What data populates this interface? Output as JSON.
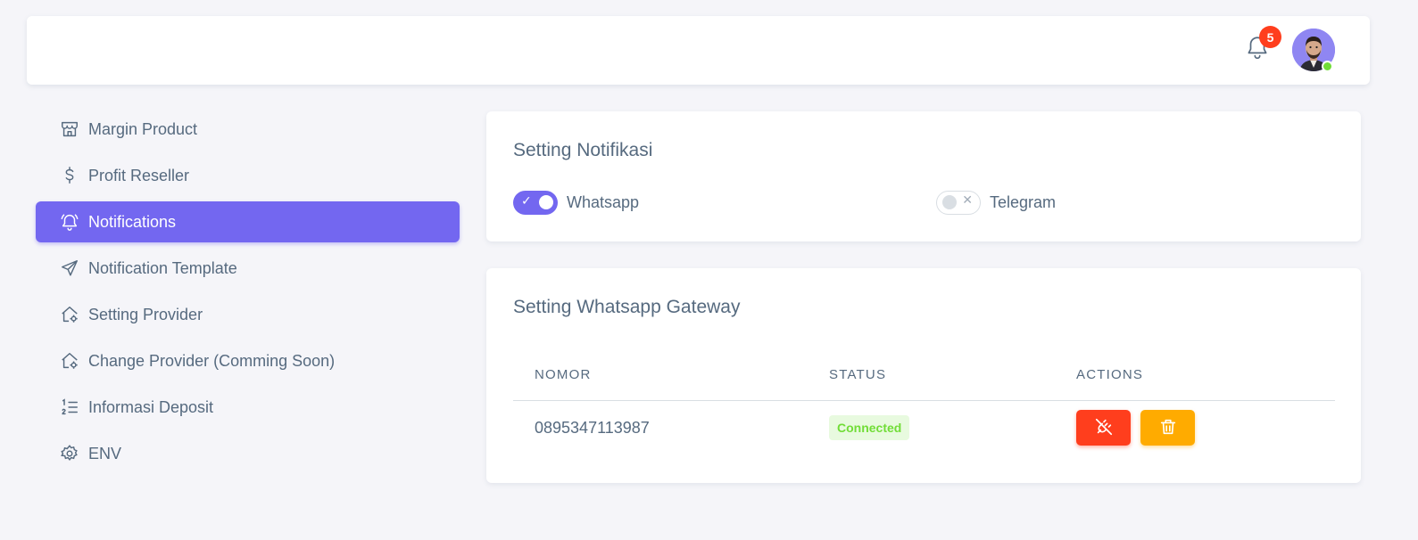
{
  "header": {
    "notifications_count": "5",
    "icons": [
      "bell-icon",
      "user-avatar"
    ]
  },
  "sidebar": {
    "items": [
      {
        "label": "Margin Product",
        "icon": "store-icon",
        "active": false
      },
      {
        "label": "Profit Reseller",
        "icon": "dollar-icon",
        "active": false
      },
      {
        "label": "Notifications",
        "icon": "bell-ringing-icon",
        "active": true
      },
      {
        "label": "Notification Template",
        "icon": "send-icon",
        "active": false
      },
      {
        "label": "Setting Provider",
        "icon": "home-cog-icon",
        "active": false
      },
      {
        "label": "Change Provider (Comming Soon)",
        "icon": "home-cog-icon",
        "active": false
      },
      {
        "label": "Informasi Deposit",
        "icon": "list-numbers-icon",
        "active": false
      },
      {
        "label": "ENV",
        "icon": "gear-icon",
        "active": false
      }
    ]
  },
  "notif_card": {
    "title": "Setting Notifikasi",
    "whatsapp": {
      "label": "Whatsapp",
      "enabled": true
    },
    "telegram": {
      "label": "Telegram",
      "enabled": false
    }
  },
  "gateway_card": {
    "title": "Setting Whatsapp Gateway",
    "columns": [
      "NOMOR",
      "STATUS",
      "ACTIONS"
    ],
    "rows": [
      {
        "nomor": "0895347113987",
        "status": "Connected"
      }
    ]
  },
  "colors": {
    "primary": "#7367f0",
    "danger": "#ff3e1d",
    "warning": "#ffab00",
    "success": "#71dd37"
  }
}
